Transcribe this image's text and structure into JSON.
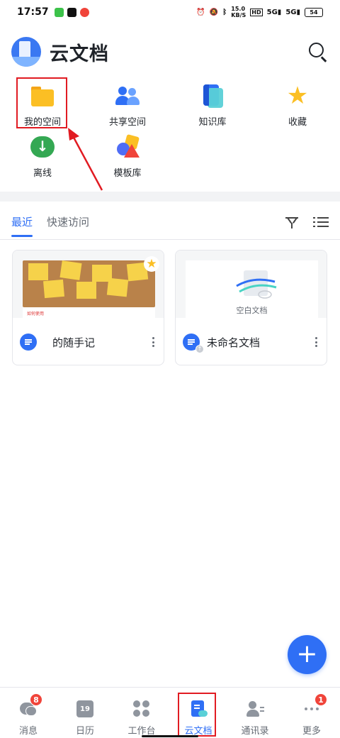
{
  "status_bar": {
    "time": "17:57",
    "speed_value": "15.0",
    "speed_unit": "KB/S",
    "hd": "HD",
    "net1": "5G",
    "net2": "5G",
    "battery": "54"
  },
  "header": {
    "title": "云文档"
  },
  "quick_access": [
    {
      "label": "我的空间",
      "icon": "folder-icon"
    },
    {
      "label": "共享空间",
      "icon": "shared-people-icon"
    },
    {
      "label": "知识库",
      "icon": "knowledge-base-icon"
    },
    {
      "label": "收藏",
      "icon": "star-icon"
    },
    {
      "label": "离线",
      "icon": "offline-download-icon"
    },
    {
      "label": "模板库",
      "icon": "template-icon"
    }
  ],
  "tabs": [
    {
      "label": "最近",
      "active": true
    },
    {
      "label": "快速访问",
      "active": false
    }
  ],
  "cards": [
    {
      "name": "的随手记",
      "thumb_caption": "如何使用",
      "starred": true
    },
    {
      "name": "未命名文档",
      "thumb_caption": "空白文档",
      "starred": false
    }
  ],
  "bottom_nav": [
    {
      "label": "消息",
      "icon": "message-icon",
      "badge": "8"
    },
    {
      "label": "日历",
      "icon": "calendar-icon",
      "calendar_day": "19"
    },
    {
      "label": "工作台",
      "icon": "workbench-icon"
    },
    {
      "label": "云文档",
      "icon": "cloud-doc-icon",
      "active": true
    },
    {
      "label": "通讯录",
      "icon": "contacts-icon"
    },
    {
      "label": "更多",
      "icon": "more-icon",
      "badge": "1"
    }
  ],
  "colors": {
    "accent": "#2f6ff5",
    "annotation": "#e11b22",
    "badge": "#f0443a",
    "folder": "#fbbf24"
  }
}
